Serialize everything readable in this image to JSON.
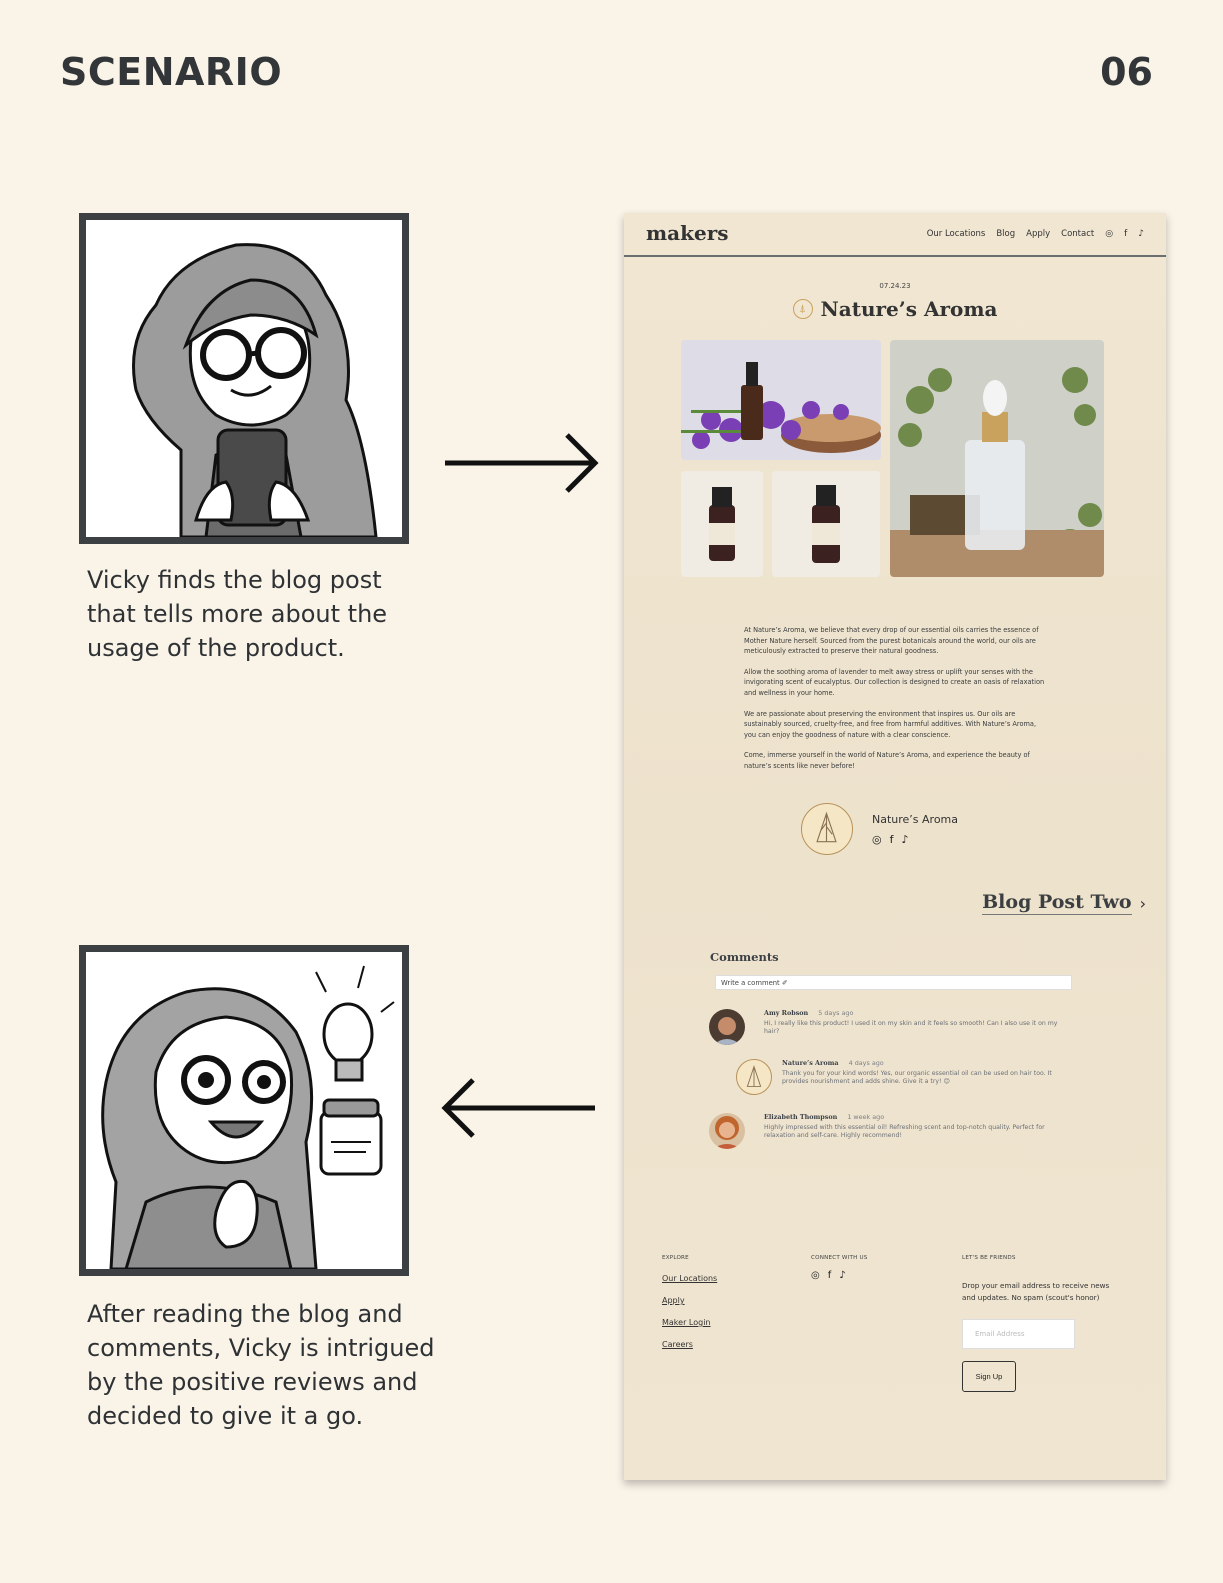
{
  "header": {
    "title": "SCENARIO",
    "page_number": "06"
  },
  "captions": {
    "first": "Vicky finds the blog post that tells more about the usage of the product.",
    "second": "After reading the blog and comments, Vicky is intrigued by the positive reviews and decided to give it a go."
  },
  "site": {
    "logo": "makers",
    "nav": [
      "Our Locations",
      "Blog",
      "Apply",
      "Contact"
    ],
    "nav_icons": [
      "instagram-icon",
      "facebook-icon",
      "tiktok-icon"
    ],
    "post": {
      "date": "07.24.23",
      "title": "Nature’s Aroma",
      "paragraphs": [
        "At Nature’s Aroma, we believe that every drop of our essential oils carries the essence of Mother Nature herself. Sourced from the purest botanicals around the world, our oils are meticulously extracted to preserve their natural goodness.",
        "Allow the soothing aroma of lavender to melt away stress or uplift your senses with the invigorating scent of eucalyptus. Our collection is designed to create an oasis of relaxation and wellness in your home.",
        "We are passionate about preserving the environment that inspires us. Our oils are sustainably sourced, cruelty-free, and free from harmful additives. With Nature’s Aroma, you can enjoy the goodness of nature with a clear conscience.",
        "Come, immerse yourself in the world of Nature’s Aroma, and experience the beauty of nature’s scents like never before!"
      ],
      "author": "Nature’s Aroma"
    },
    "next_post": "Blog Post Two",
    "comments": {
      "title": "Comments",
      "placeholder": "Write a comment ✐",
      "items": [
        {
          "author": "Amy Robson",
          "age": "5 days ago",
          "text": "Hi, I really like this product! I used it on my skin and it feels so smooth! Can I also use it on my hair?"
        },
        {
          "author": "Nature’s Aroma",
          "age": "4 days ago",
          "text": "Thank you for your kind words! Yes, our organic essential oil can be used on hair too. It provides nourishment and adds shine. Give it a try! 😊"
        },
        {
          "author": "Elizabeth Thompson",
          "age": "1 week ago",
          "text": "Highly impressed with this essential oil! Refreshing scent and top-notch quality. Perfect for relaxation and self-care. Highly recommend!"
        }
      ]
    },
    "footer": {
      "explore_title": "EXPLORE",
      "explore_links": [
        "Our Locations",
        "Apply",
        "Maker Login",
        "Careers"
      ],
      "connect_title": "CONNECT WITH US",
      "friends_title": "LET'S BE FRIENDS",
      "friends_note": "Drop your email address to receive news and updates. No spam (scout's honor)",
      "email_placeholder": "Email Address",
      "signup_label": "Sign Up"
    }
  },
  "colors": {
    "background": "#f9f3e8",
    "site_background": "#efe5d1",
    "accent_gold": "#c9a25e",
    "frame": "#3c4043"
  }
}
